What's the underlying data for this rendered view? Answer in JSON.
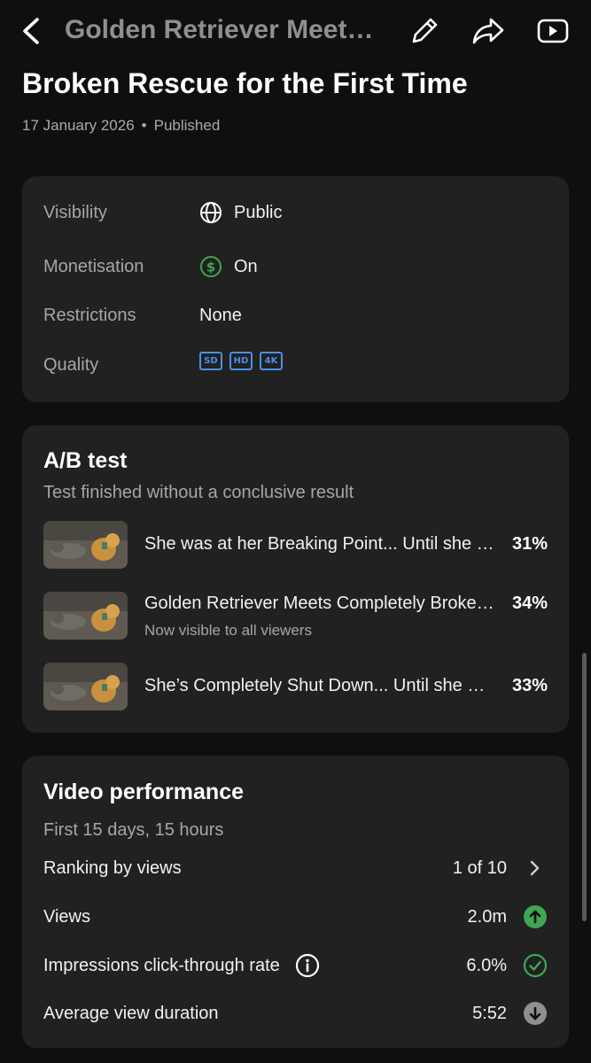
{
  "header": {
    "title": "Golden Retriever Meets Completely Broken Rescue for the First Time",
    "icons": [
      "back-arrow-icon",
      "pencil-icon",
      "share-icon",
      "youtube-icon"
    ]
  },
  "video": {
    "title": "Golden Retriever Meets Completely Broken Rescue for the First Time",
    "date": "17 January 2026",
    "separator": "•",
    "status": "Published"
  },
  "details": {
    "visibility_label": "Visibility",
    "visibility_value": "Public",
    "monetisation_label": "Monetisation",
    "monetisation_value": "On",
    "restrictions_label": "Restrictions",
    "restrictions_value": "None",
    "quality_label": "Quality",
    "quality_badges": [
      "SD",
      "HD",
      "4K"
    ],
    "colors": {
      "monetisation": "#3ea650",
      "quality": "#4a8fe7"
    }
  },
  "ab_test": {
    "heading": "A/B test",
    "subtitle": "Test finished without a conclusive result",
    "items": [
      {
        "title": "She was at her Breaking Point... Until she Met This Golden Retriever",
        "percent": "31%",
        "note": ""
      },
      {
        "title": "Golden Retriever Meets Completely Broken Rescue for the First Time",
        "percent": "34%",
        "note": "Now visible to all viewers"
      },
      {
        "title": "She’s Completely Shut Down... Until she Met This Golden Retriever",
        "percent": "33%",
        "note": ""
      }
    ]
  },
  "performance": {
    "heading": "Video performance",
    "subtitle": "First 15 days, 15 hours",
    "ranking_label": "Ranking by views",
    "ranking_value": "1 of 10",
    "views_label": "Views",
    "views_value": "2.0m",
    "ctr_label": "Impressions click-through rate",
    "ctr_value": "6.0%",
    "avd_label": "Average view duration",
    "avd_value": "5:52",
    "colors": {
      "up": "#3ea650",
      "neutral_ok": "#3ea650",
      "down": "#909090"
    }
  }
}
